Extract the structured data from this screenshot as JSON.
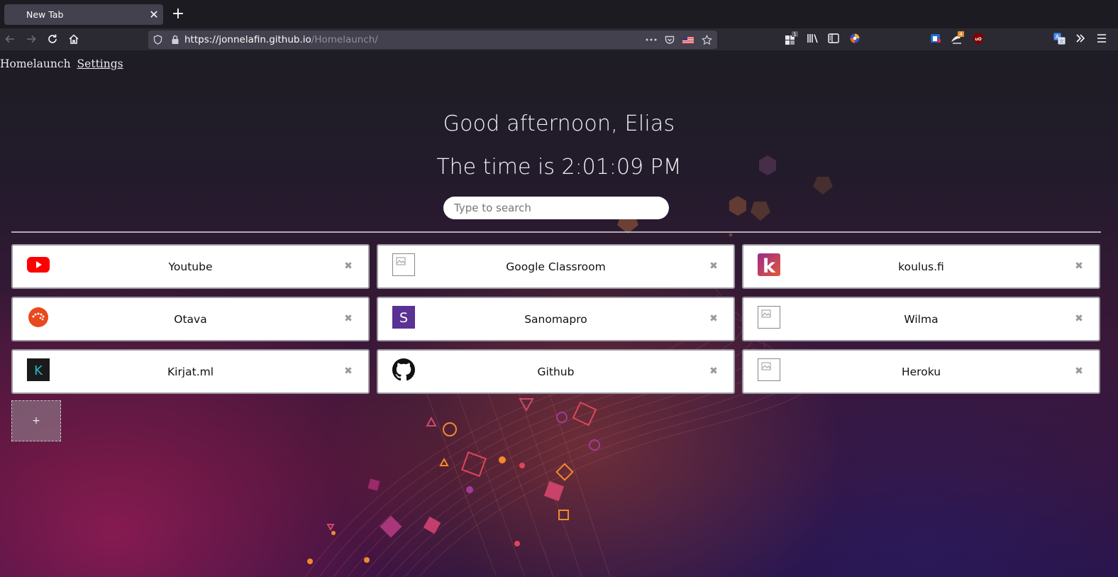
{
  "browser": {
    "tab_title": "New Tab",
    "tab_close": "✕",
    "new_tab": "+",
    "url_domain": "https://jonnelafin.github.io",
    "url_path": "/Homelaunch/",
    "badges": {
      "containers": "1",
      "notes": "4"
    },
    "icons": [
      "back-icon",
      "forward-icon",
      "reload-icon",
      "home-icon",
      "shield-icon",
      "lock-icon",
      "more-icon",
      "pocket-icon",
      "flag-icon",
      "bookmark-star-icon",
      "extensions-icon",
      "library-icon",
      "sidebar-icon",
      "firefox-color-icon",
      "container-icon",
      "note-icon",
      "ublock-icon",
      "translate-icon",
      "overflow-icon",
      "menu-icon"
    ]
  },
  "nav": {
    "home_label": "Homelaunch",
    "settings_label": "Settings"
  },
  "greeting": "Good afternoon, Elias",
  "time_text": "The time is 2:01:09 PM",
  "search": {
    "placeholder": "Type to search"
  },
  "shortcuts": [
    {
      "label": "Youtube",
      "icon": "youtube-icon",
      "close": "✖"
    },
    {
      "label": "Google Classroom",
      "icon": "broken-image-icon",
      "close": "✖"
    },
    {
      "label": "koulus.fi",
      "icon": "koulus-icon",
      "close": "✖"
    },
    {
      "label": "Otava",
      "icon": "otava-icon",
      "close": "✖"
    },
    {
      "label": "Sanomapro",
      "icon": "sanomapro-icon",
      "close": "✖"
    },
    {
      "label": "Wilma",
      "icon": "broken-image-icon",
      "close": "✖"
    },
    {
      "label": "Kirjat.ml",
      "icon": "kirjat-icon",
      "close": "✖"
    },
    {
      "label": "Github",
      "icon": "github-icon",
      "close": "✖"
    },
    {
      "label": "Heroku",
      "icon": "broken-image-icon",
      "close": "✖"
    }
  ],
  "icon_text": {
    "sanomapro": "S",
    "kirjat": "K",
    "koulus": "k"
  },
  "add_label": "+",
  "colors": {
    "youtube": "#ff0000",
    "otava": "#e8491d",
    "sanomapro": "#5a3194",
    "kirjat_bg": "#1a1a1a",
    "kirjat_fg": "#2ab8c9"
  }
}
